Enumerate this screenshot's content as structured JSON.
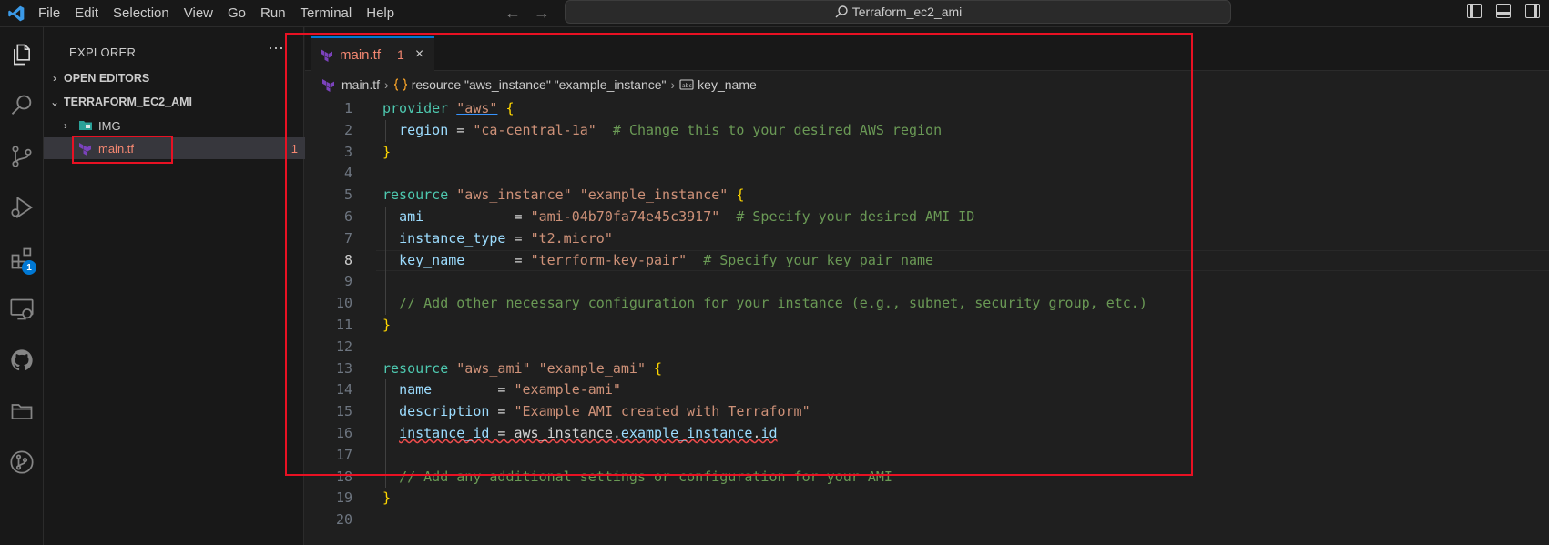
{
  "window": {
    "menu": [
      "File",
      "Edit",
      "Selection",
      "View",
      "Go",
      "Run",
      "Terminal",
      "Help"
    ],
    "search_title": "Terraform_ec2_ami"
  },
  "activity_bar": {
    "icons": [
      "explorer-icon",
      "search-icon",
      "source-control-icon",
      "run-debug-icon",
      "extensions-icon",
      "remote-explorer-icon",
      "github-icon",
      "folder-icon",
      "git-graph-icon"
    ],
    "extensions_badge": "1"
  },
  "sidebar": {
    "title": "EXPLORER",
    "more": "···",
    "open_editors": "OPEN EDITORS",
    "folder": "TERRAFORM_EC2_AMI",
    "items": [
      {
        "label": "IMG",
        "kind": "folder"
      },
      {
        "label": "main.tf",
        "kind": "terraform-file",
        "problems": "1"
      }
    ]
  },
  "editor": {
    "tab": {
      "label": "main.tf",
      "problems": "1",
      "close": "×"
    },
    "breadcrumb": [
      "main.tf",
      "resource \"aws_instance\" \"example_instance\"",
      "key_name"
    ],
    "active_line": 8,
    "lines": [
      {
        "n": "1",
        "tokens": [
          [
            "kw",
            "provider "
          ],
          [
            "str ul",
            "\"aws\""
          ],
          [
            "pl",
            " "
          ],
          [
            "br",
            "{"
          ]
        ]
      },
      {
        "n": "2",
        "tokens": [
          [
            "pl",
            "  "
          ],
          [
            "prop",
            "region"
          ],
          [
            "pl",
            " = "
          ],
          [
            "str",
            "\"ca-central-1a\""
          ],
          [
            "pl",
            "  "
          ],
          [
            "cm",
            "# Change this to your desired AWS region"
          ]
        ]
      },
      {
        "n": "3",
        "tokens": [
          [
            "br",
            "}"
          ]
        ]
      },
      {
        "n": "4",
        "tokens": []
      },
      {
        "n": "5",
        "tokens": [
          [
            "kw",
            "resource "
          ],
          [
            "str",
            "\"aws_instance\""
          ],
          [
            "pl",
            " "
          ],
          [
            "str",
            "\"example_instance\""
          ],
          [
            "pl",
            " "
          ],
          [
            "br",
            "{"
          ]
        ]
      },
      {
        "n": "6",
        "tokens": [
          [
            "pl",
            "  "
          ],
          [
            "prop",
            "ami"
          ],
          [
            "pl",
            "           = "
          ],
          [
            "str",
            "\"ami-04b70fa74e45c3917\""
          ],
          [
            "pl",
            "  "
          ],
          [
            "cm",
            "# Specify your desired AMI ID"
          ]
        ]
      },
      {
        "n": "7",
        "tokens": [
          [
            "pl",
            "  "
          ],
          [
            "prop",
            "instance_type"
          ],
          [
            "pl",
            " = "
          ],
          [
            "str",
            "\"t2.micro\""
          ]
        ]
      },
      {
        "n": "8",
        "tokens": [
          [
            "pl",
            "  "
          ],
          [
            "prop",
            "key_name"
          ],
          [
            "pl",
            "      = "
          ],
          [
            "str",
            "\"terrform-key-pair\""
          ],
          [
            "pl",
            "  "
          ],
          [
            "cm",
            "# Specify your key pair name"
          ]
        ]
      },
      {
        "n": "9",
        "tokens": []
      },
      {
        "n": "10",
        "tokens": [
          [
            "pl",
            "  "
          ],
          [
            "cm",
            "// Add other necessary configuration for your instance (e.g., subnet, security group, etc.)"
          ]
        ]
      },
      {
        "n": "11",
        "tokens": [
          [
            "br",
            "}"
          ]
        ]
      },
      {
        "n": "12",
        "tokens": []
      },
      {
        "n": "13",
        "tokens": [
          [
            "kw",
            "resource "
          ],
          [
            "str",
            "\"aws_ami\""
          ],
          [
            "pl",
            " "
          ],
          [
            "str",
            "\"example_ami\""
          ],
          [
            "pl",
            " "
          ],
          [
            "br",
            "{"
          ]
        ]
      },
      {
        "n": "14",
        "tokens": [
          [
            "pl",
            "  "
          ],
          [
            "prop",
            "name"
          ],
          [
            "pl",
            "        = "
          ],
          [
            "str",
            "\"example-ami\""
          ]
        ]
      },
      {
        "n": "15",
        "tokens": [
          [
            "pl",
            "  "
          ],
          [
            "prop",
            "description"
          ],
          [
            "pl",
            " = "
          ],
          [
            "str",
            "\"Example AMI created with Terraform\""
          ]
        ]
      },
      {
        "n": "16",
        "tokens": [
          [
            "pl",
            "  "
          ],
          [
            "prop sq",
            "instance_id"
          ],
          [
            "pl sq",
            " = aws_instance."
          ],
          [
            "prop sq",
            "example_instance"
          ],
          [
            "pl sq",
            "."
          ],
          [
            "prop sq",
            "id"
          ]
        ]
      },
      {
        "n": "17",
        "tokens": []
      },
      {
        "n": "18",
        "tokens": [
          [
            "pl",
            "  "
          ],
          [
            "cm",
            "// Add any additional settings or configuration for your AMI"
          ]
        ]
      },
      {
        "n": "19",
        "tokens": [
          [
            "br",
            "}"
          ]
        ]
      },
      {
        "n": "20",
        "tokens": []
      }
    ]
  },
  "colors": {
    "highlight_box": "#e81123",
    "terraform": "#7b42bc"
  }
}
